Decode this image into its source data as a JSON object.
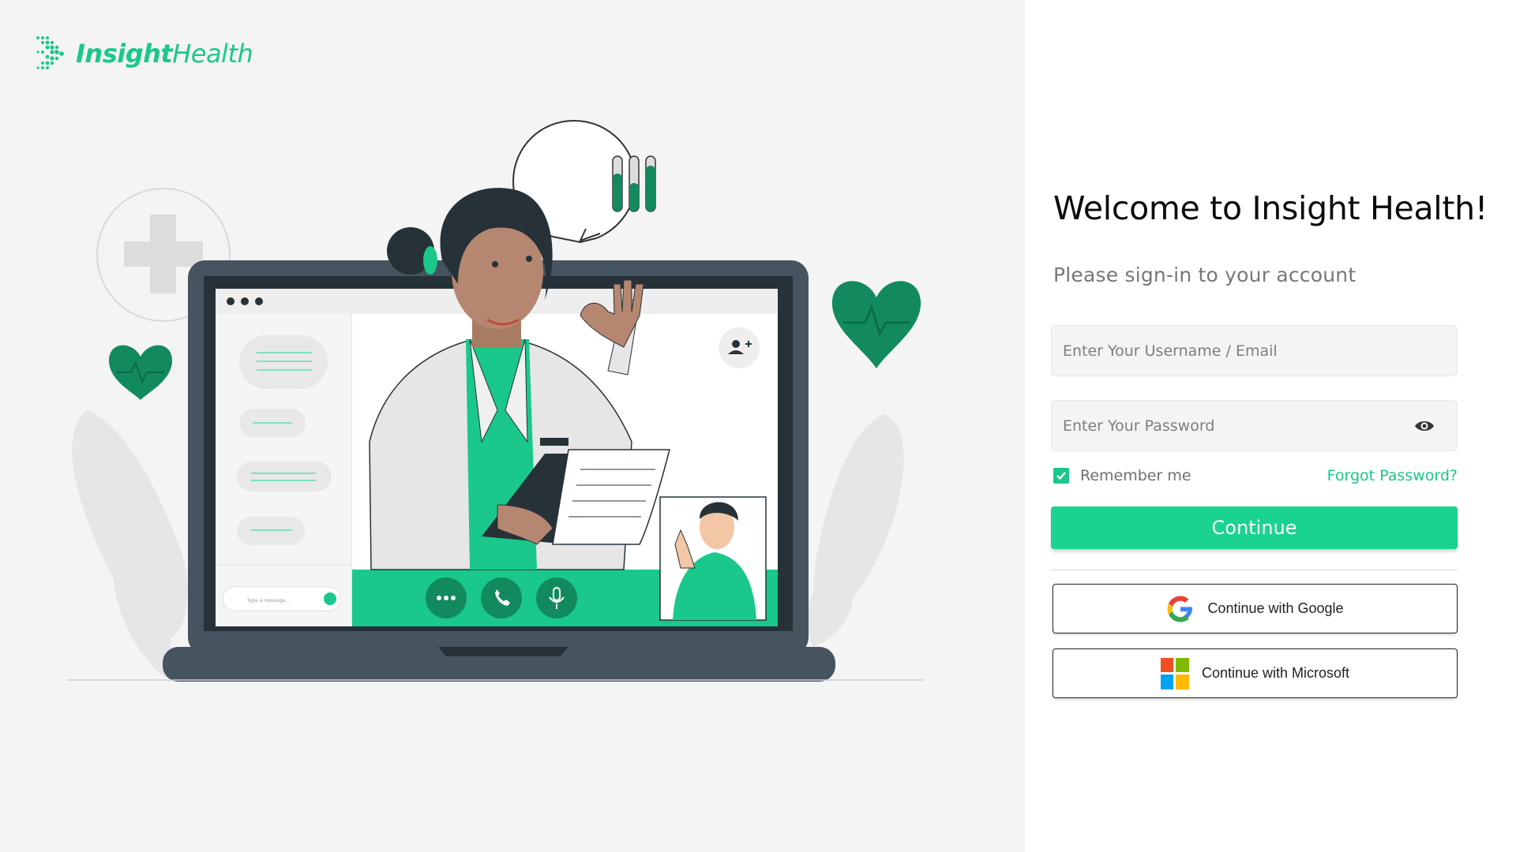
{
  "brand": {
    "name_bold": "Insight",
    "name_light": "Health",
    "accent_color": "#19c88a",
    "logo_icon": "dotted-arrow-icon"
  },
  "illustration": {
    "chat_input_placeholder": "Type a message...",
    "icons": [
      "medical-cross-icon",
      "heart-pulse-icon",
      "bar-chart-bubble-icon",
      "add-user-icon",
      "more-icon",
      "phone-icon",
      "microphone-icon",
      "send-icon"
    ]
  },
  "login": {
    "title": "Welcome to Insight Health!",
    "subtitle": "Please sign-in to your account",
    "username_placeholder": "Enter Your Username / Email",
    "username_value": "",
    "password_placeholder": "Enter Your Password",
    "password_value": "",
    "remember_label": "Remember me",
    "remember_checked": true,
    "forgot_label": "Forgot Password?",
    "continue_label": "Continue",
    "google_label": "Continue with Google",
    "microsoft_label": "Continue with Microsoft",
    "microsoft_colors": [
      "#f25022",
      "#7fba00",
      "#00a4ef",
      "#ffb900"
    ],
    "google_colors": [
      "#4285f4",
      "#34a853",
      "#fbbc05",
      "#ea4335"
    ]
  }
}
